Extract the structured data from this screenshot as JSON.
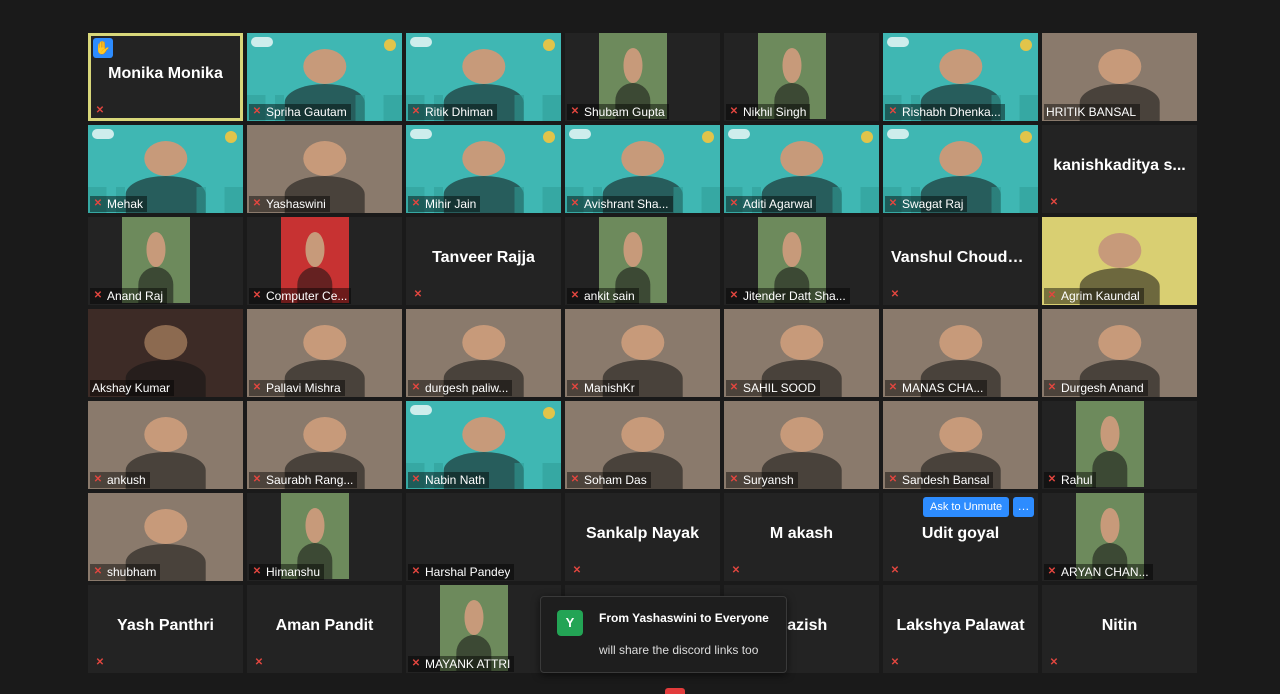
{
  "grid": [
    {
      "name": "Monika Monika",
      "video": false,
      "active": true,
      "raise_hand": true,
      "muted": false
    },
    {
      "name": "Spriha Gautam",
      "video": true,
      "bg": "teal"
    },
    {
      "name": "Ritik Dhiman",
      "video": true,
      "bg": "teal"
    },
    {
      "name": "Shubam Gupta",
      "video": true,
      "bg": "photo"
    },
    {
      "name": "Nikhil Singh",
      "video": true,
      "bg": "photo"
    },
    {
      "name": "Rishabh Dhenka...",
      "video": true,
      "bg": "teal"
    },
    {
      "name": "HRITIK BANSAL",
      "video": true,
      "bg": "room",
      "muted": false
    },
    {
      "name": "Mehak",
      "video": true,
      "bg": "teal"
    },
    {
      "name": "Yashaswini",
      "video": true,
      "bg": "room"
    },
    {
      "name": "Mihir Jain",
      "video": true,
      "bg": "teal"
    },
    {
      "name": "Avishrant Sha...",
      "video": true,
      "bg": "teal"
    },
    {
      "name": "Aditi Agarwal",
      "video": true,
      "bg": "teal"
    },
    {
      "name": "Swagat Raj",
      "video": true,
      "bg": "teal"
    },
    {
      "name": "kanishkaditya s...",
      "video": false
    },
    {
      "name": "Anand Raj",
      "video": true,
      "bg": "photo"
    },
    {
      "name": "Computer Ce...",
      "video": true,
      "bg": "logo"
    },
    {
      "name": "Tanveer Rajja",
      "video": false
    },
    {
      "name": "ankit sain",
      "video": true,
      "bg": "photo"
    },
    {
      "name": "Jitender Datt Sha...",
      "video": true,
      "bg": "photo"
    },
    {
      "name": "Vanshul Choudh...",
      "video": false
    },
    {
      "name": "Agrim Kaundal",
      "video": true,
      "bg": "yellow"
    },
    {
      "name": "Akshay Kumar",
      "video": true,
      "bg": "dark",
      "muted": false
    },
    {
      "name": "Pallavi Mishra",
      "video": true,
      "bg": "room"
    },
    {
      "name": "durgesh paliw...",
      "video": true,
      "bg": "room"
    },
    {
      "name": "ManishKr",
      "video": true,
      "bg": "room"
    },
    {
      "name": "SAHIL SOOD",
      "video": true,
      "bg": "room"
    },
    {
      "name": "MANAS CHA...",
      "video": true,
      "bg": "room"
    },
    {
      "name": "Durgesh Anand",
      "video": true,
      "bg": "room"
    },
    {
      "name": "ankush",
      "video": true,
      "bg": "room"
    },
    {
      "name": "Saurabh Rang...",
      "video": true,
      "bg": "room"
    },
    {
      "name": "Nabin Nath",
      "video": true,
      "bg": "teal"
    },
    {
      "name": "Soham Das",
      "video": true,
      "bg": "room"
    },
    {
      "name": "Suryansh",
      "video": true,
      "bg": "room"
    },
    {
      "name": "Sandesh Bansal",
      "video": true,
      "bg": "room"
    },
    {
      "name": "Rahul",
      "video": true,
      "bg": "photo"
    },
    {
      "name": "shubham",
      "video": true,
      "bg": "room"
    },
    {
      "name": "Himanshu",
      "video": true,
      "bg": "photo"
    },
    {
      "name": "Harshal Pandey",
      "video": false,
      "label_only": true
    },
    {
      "name": "Sankalp Nayak",
      "video": false
    },
    {
      "name": "M akash",
      "video": false
    },
    {
      "name": "Udit goyal",
      "video": false,
      "hover": true
    },
    {
      "name": "ARYAN CHAN...",
      "video": true,
      "bg": "photo"
    },
    {
      "name": "Yash Panthri",
      "video": false
    },
    {
      "name": "Aman Pandit",
      "video": false
    },
    {
      "name": "MAYANK ATTRI",
      "video": true,
      "bg": "photo"
    },
    {
      "name": "",
      "video": false,
      "hidden": true
    },
    {
      "name": "Nazish",
      "video": false
    },
    {
      "name": "Lakshya Palawat",
      "video": false
    },
    {
      "name": "Nitin",
      "video": false
    }
  ],
  "controls": {
    "ask_to_unmute": "Ask to Unmute",
    "more": "…"
  },
  "chat": {
    "avatar_letter": "Y",
    "header": "From Yashaswini to Everyone",
    "message": "will share the discord links too"
  },
  "colors": {
    "accent": "#2d8cff",
    "muted_icon": "#e2463f",
    "active_border": "#d8d77a",
    "chat_avatar": "#23a455"
  }
}
